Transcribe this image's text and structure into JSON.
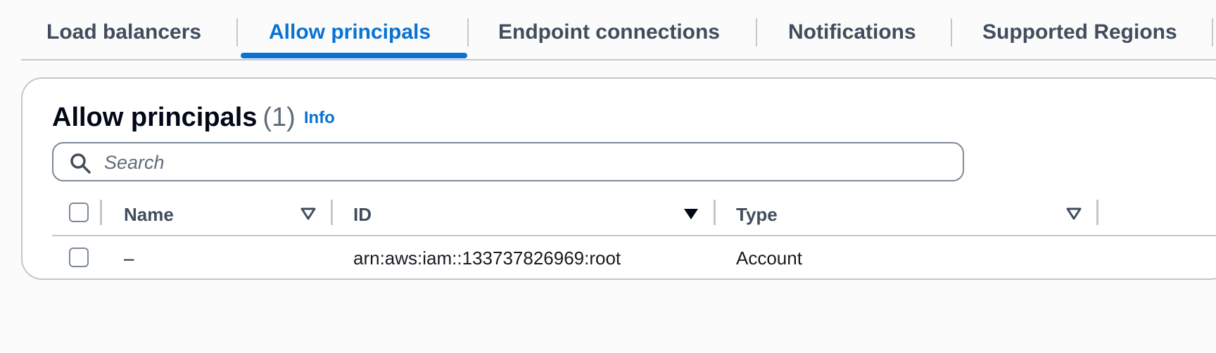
{
  "tabs": [
    {
      "label": "Load balancers",
      "active": false
    },
    {
      "label": "Allow principals",
      "active": true
    },
    {
      "label": "Endpoint connections",
      "active": false
    },
    {
      "label": "Notifications",
      "active": false
    },
    {
      "label": "Supported Regions",
      "active": false
    }
  ],
  "panel": {
    "title": "Allow principals",
    "count": "(1)",
    "info_label": "Info"
  },
  "search": {
    "placeholder": "Search",
    "value": ""
  },
  "table": {
    "columns": [
      {
        "label": "Name",
        "sort": "none"
      },
      {
        "label": "ID",
        "sort": "descending"
      },
      {
        "label": "Type",
        "sort": "none"
      }
    ],
    "rows": [
      {
        "name": "–",
        "id": "arn:aws:iam::133737826969:root",
        "type": "Account"
      }
    ]
  },
  "colors": {
    "accent": "#0972d3",
    "tab_text": "#414d5c",
    "border": "#c6c6cd"
  },
  "icons": {
    "search": "search-icon",
    "sort_none": "sort-unsorted-icon",
    "sort_desc": "sort-descending-icon"
  }
}
